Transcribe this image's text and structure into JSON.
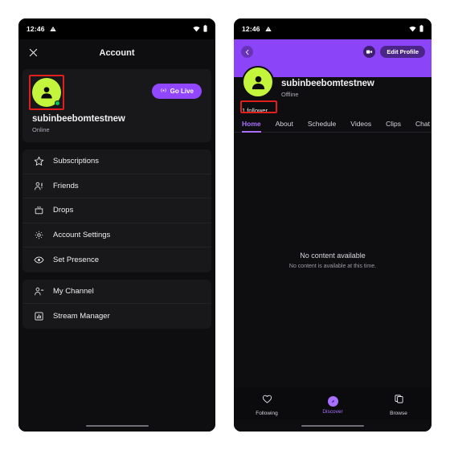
{
  "status_bar": {
    "time": "12:46",
    "icons": [
      "warning-triangle-icon",
      "wifi-icon",
      "battery-icon"
    ]
  },
  "left_panel": {
    "header": {
      "close_icon": "close-icon",
      "title": "Account"
    },
    "profile": {
      "avatar_icon": "person-avatar-icon",
      "username": "subinbeebomtestnew",
      "status": "Online",
      "go_live_label": "Go Live",
      "go_live_icon": "broadcast-icon",
      "highlighted": true
    },
    "menu_groups": [
      {
        "items": [
          {
            "label": "Subscriptions",
            "icon": "star-icon"
          },
          {
            "label": "Friends",
            "icon": "friends-icon"
          },
          {
            "label": "Drops",
            "icon": "gift-box-icon"
          },
          {
            "label": "Account Settings",
            "icon": "gear-icon"
          },
          {
            "label": "Set Presence",
            "icon": "eye-icon"
          }
        ]
      },
      {
        "items": [
          {
            "label": "My Channel",
            "icon": "person-add-icon"
          },
          {
            "label": "Stream Manager",
            "icon": "chart-bar-icon"
          }
        ]
      }
    ]
  },
  "right_panel": {
    "banner": {
      "color": "#8b44f7",
      "back_icon": "chevron-left-icon",
      "camera_icon": "video-camera-icon",
      "edit_profile_label": "Edit Profile"
    },
    "profile": {
      "avatar_icon": "person-avatar-icon",
      "username": "subinbeebomtestnew",
      "status": "Offline",
      "followers": "1 follower",
      "followers_highlighted": true
    },
    "tabs": [
      {
        "label": "Home",
        "active": true
      },
      {
        "label": "About",
        "active": false
      },
      {
        "label": "Schedule",
        "active": false
      },
      {
        "label": "Videos",
        "active": false
      },
      {
        "label": "Clips",
        "active": false
      },
      {
        "label": "Chat",
        "active": false
      }
    ],
    "empty_state": {
      "title": "No content available",
      "subtitle": "No content is available at this time."
    },
    "bottom_nav": [
      {
        "label": "Following",
        "icon": "heart-icon",
        "active": false
      },
      {
        "label": "Discover",
        "icon": "compass-icon",
        "active": true
      },
      {
        "label": "Browse",
        "icon": "copy-icon",
        "active": false
      }
    ]
  },
  "accent_colors": {
    "purple": "#9147ff",
    "tab_purple": "#a970ff",
    "banner_purple": "#8b44f7",
    "avatar_green": "#c3f53c",
    "highlight_red": "#e01e1e",
    "online_green": "#00c853"
  }
}
